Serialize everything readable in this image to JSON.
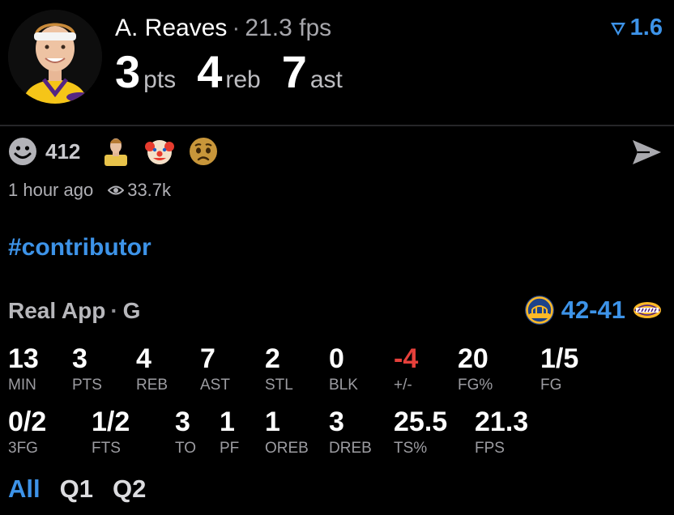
{
  "player": {
    "name": "A. Reaves",
    "fps": "21.3 fps",
    "rating": "1.6",
    "summary": [
      {
        "value": "3",
        "unit": "pts"
      },
      {
        "value": "4",
        "unit": "reb"
      },
      {
        "value": "7",
        "unit": "ast"
      }
    ]
  },
  "reactions": {
    "count": "412",
    "items": [
      "player-avatar-reaction",
      "clown-face-emoji",
      "pleading-face-emoji"
    ]
  },
  "meta": {
    "time_ago": "1 hour ago",
    "views": "33.7k"
  },
  "hashtag": "#contributor",
  "game": {
    "league": "Real App",
    "position": "G",
    "score": "42-41",
    "home_team_icon": "warriors-logo-icon",
    "away_team_icon": "lakers-logo-icon"
  },
  "stats_row1": [
    {
      "value": "13",
      "label": "MIN"
    },
    {
      "value": "3",
      "label": "PTS"
    },
    {
      "value": "4",
      "label": "REB"
    },
    {
      "value": "7",
      "label": "AST"
    },
    {
      "value": "2",
      "label": "STL"
    },
    {
      "value": "0",
      "label": "BLK"
    },
    {
      "value": "-4",
      "label": "+/-"
    },
    {
      "value": "20",
      "label": "FG%"
    },
    {
      "value": "1/5",
      "label": "FG"
    }
  ],
  "stats_row2": [
    {
      "value": "0/2",
      "label": "3FG"
    },
    {
      "value": "1/2",
      "label": "FTS"
    },
    {
      "value": "3",
      "label": "TO"
    },
    {
      "value": "1",
      "label": "PF"
    },
    {
      "value": "1",
      "label": "OREB"
    },
    {
      "value": "3",
      "label": "DREB"
    },
    {
      "value": "25.5",
      "label": "TS%"
    },
    {
      "value": "21.3",
      "label": "FPS"
    }
  ],
  "tabs": [
    "All",
    "Q1",
    "Q2"
  ],
  "colors": {
    "accent": "#3d93e8",
    "negative": "#e5403b",
    "background": "#000000"
  }
}
